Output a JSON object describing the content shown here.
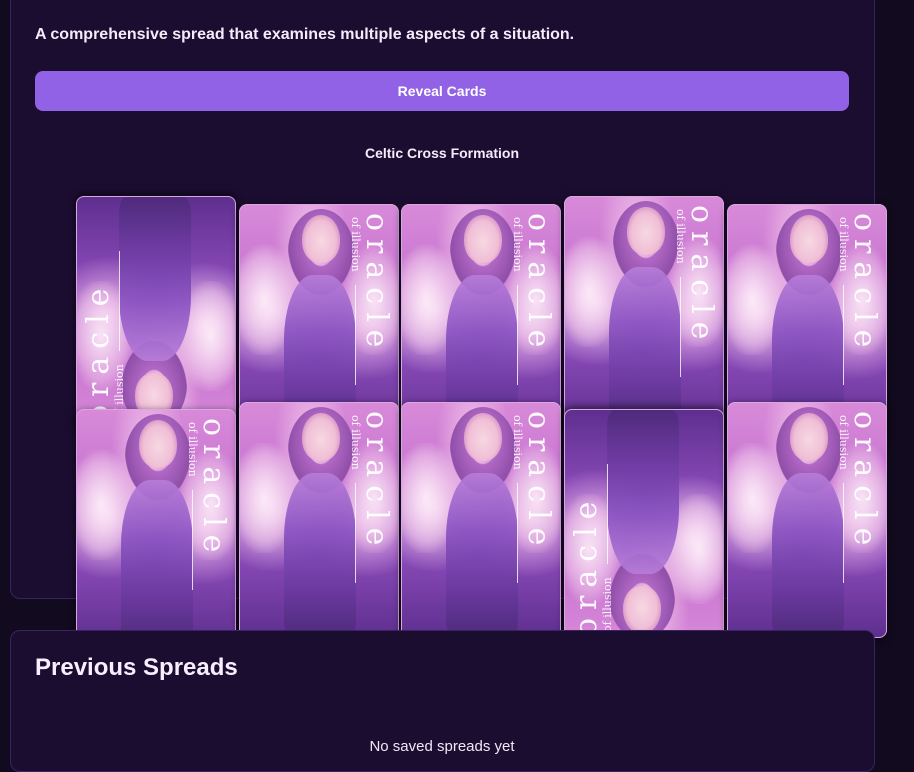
{
  "spread": {
    "description": "A comprehensive spread that examines multiple aspects of a situation.",
    "reveal_button_label": "Reveal Cards",
    "formation_title": "Celtic Cross Formation",
    "cards": [
      {
        "name": "card-1",
        "orientation": "reversed",
        "brand": "oracle",
        "subtitle": "of illusion"
      },
      {
        "name": "card-2",
        "orientation": "upright",
        "brand": "oracle",
        "subtitle": "of illusion"
      },
      {
        "name": "card-3",
        "orientation": "upright",
        "brand": "oracle",
        "subtitle": "of illusion"
      },
      {
        "name": "card-4",
        "orientation": "upright",
        "brand": "oracle",
        "subtitle": "of illusion"
      },
      {
        "name": "card-5",
        "orientation": "upright",
        "brand": "oracle",
        "subtitle": "of illusion"
      },
      {
        "name": "card-6",
        "orientation": "upright",
        "brand": "oracle",
        "subtitle": "of illusion"
      },
      {
        "name": "card-7",
        "orientation": "upright",
        "brand": "oracle",
        "subtitle": "of illusion"
      },
      {
        "name": "card-8",
        "orientation": "upright",
        "brand": "oracle",
        "subtitle": "of illusion"
      },
      {
        "name": "card-9",
        "orientation": "reversed",
        "brand": "oracle",
        "subtitle": "of illusion"
      },
      {
        "name": "card-10",
        "orientation": "upright",
        "brand": "oracle",
        "subtitle": "of illusion"
      }
    ]
  },
  "history": {
    "title": "Previous Spreads",
    "empty_text": "No saved spreads yet"
  },
  "colors": {
    "background": "#120a1f",
    "panel": "#1b0d30",
    "accent": "#9262e6"
  }
}
